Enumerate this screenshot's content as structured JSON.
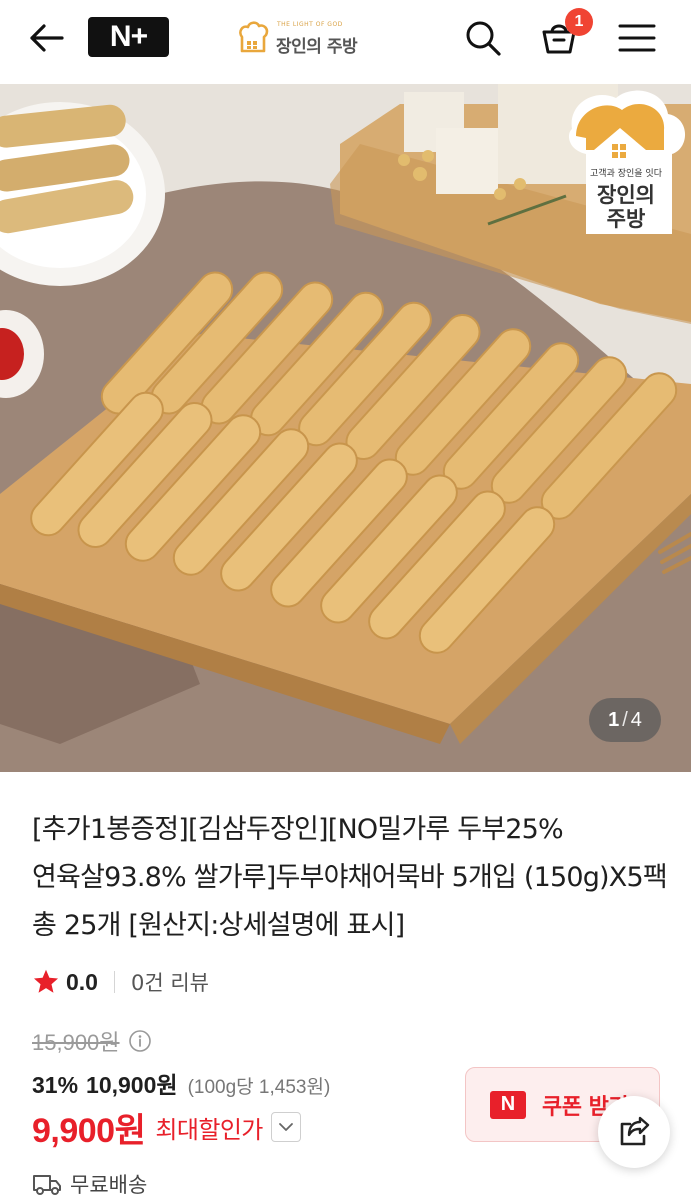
{
  "header": {
    "back_icon": "arrow-left-icon",
    "badge_label": "N+",
    "brand_tagline": "THE LIGHT OF GOD",
    "brand_name": "장인의 주방",
    "search_icon": "search-icon",
    "cart_icon": "cart-icon",
    "cart_count": "1",
    "menu_icon": "hamburger-menu-icon"
  },
  "hero": {
    "logo_tagline": "고객과 장인을 잇다",
    "logo_line1": "장인의",
    "logo_line2": "주방",
    "counter_current": "1",
    "counter_sep": "/",
    "counter_total": "4"
  },
  "product": {
    "title": "[추가1봉증정][김삼두장인][NO밀가루 두부25% 연육살93.8% 쌀가루]두부야채어묵바 5개입 (150g)X5팩 총 25개 [원산지:상세설명에 표시]",
    "rating": "0.0",
    "reviews": "0건 리뷰",
    "original_price": "15,900원",
    "discount_rate": "31%",
    "discount_price": "10,900원",
    "unit_price": "(100g당 1,453원)",
    "max_discount_price": "9,900원",
    "max_discount_label": "최대할인가",
    "coupon_label": "쿠폰 받기",
    "shipping": "무료배송"
  },
  "colors": {
    "accent_red": "#e8202a",
    "badge_red": "#f04433",
    "brand_gold": "#e9a73c"
  }
}
